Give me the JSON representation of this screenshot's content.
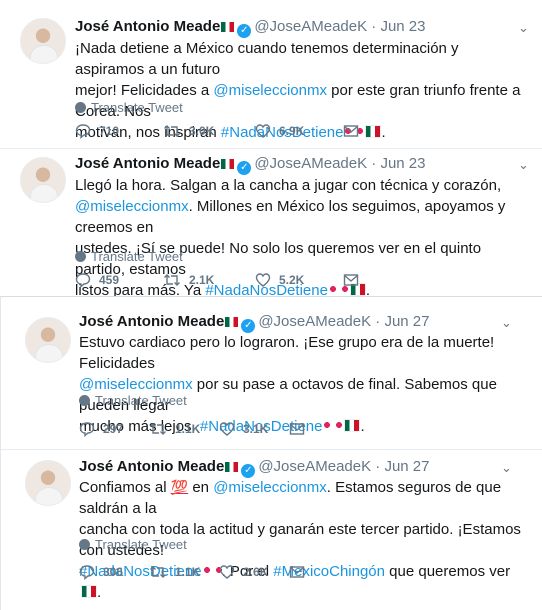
{
  "tweets": [
    {
      "name": "José Antonio Meade",
      "handle": "@JoseAMeadeK",
      "dot": "·",
      "date": "Jun 23",
      "lines": [
        "¡Nada detiene a México cuando tenemos determinación y aspiramos a un futuro",
        [
          "mejor! Felicidades a ",
          "@miseleccionmx",
          " por este gran triunfo frente a Corea. Nos"
        ],
        [
          "motivan, nos inspiran ",
          "#NadaNosDetiene"
        ]
      ],
      "translate": "Translate Tweet",
      "replies": "710",
      "retweets": "3.0K",
      "likes": "6.9K"
    },
    {
      "name": "José Antonio Meade",
      "handle": "@JoseAMeadeK",
      "dot": "·",
      "date": "Jun 23",
      "lines": [
        "Llegó la hora. Salgan a la cancha a jugar con técnica y corazón,",
        [
          "@miseleccionmx",
          ". Millones en México los seguimos, apoyamos y creemos en"
        ],
        "ustedes. ¡Sí se puede! No solo los queremos ver en el quinto partido, estamos",
        [
          "listos para más. Ya ",
          "#NadaNosDetiene"
        ]
      ],
      "translate": "Translate Tweet",
      "replies": "459",
      "retweets": "2.1K",
      "likes": "5.2K"
    },
    {
      "name": "José Antonio Meade",
      "handle": "@JoseAMeadeK",
      "dot": "·",
      "date": "Jun 27",
      "lines": [
        "Estuvo cardiaco pero lo lograron. ¡Ese grupo era de la muerte! Felicidades",
        [
          "@miseleccionmx",
          " por su pase a octavos de final. Sabemos que pueden llegar"
        ],
        [
          "mucho más lejos. ",
          "#NadaNosDetiene"
        ]
      ],
      "translate": "Translate Tweet",
      "replies": "297",
      "retweets": "1.1K",
      "likes": "3.1K"
    },
    {
      "name": "José Antonio Meade",
      "handle": "@JoseAMeadeK",
      "dot": "·",
      "date": "Jun 27",
      "lines": [
        [
          "Confiamos al ",
          "💯",
          " en ",
          "@miseleccionmx",
          ". Estamos seguros de que saldrán a la"
        ],
        "cancha con toda la actitud y ganarán este tercer partido. ¡Estamos con ustedes!",
        [
          "#NadaNosDetiene",
          ". Por el ",
          "#MexicoChingón",
          " que queremos ver"
        ]
      ],
      "translate": "Translate Tweet",
      "replies": "306",
      "retweets": "1.1K",
      "likes": "2.6K"
    }
  ],
  "icons": {
    "reply": "reply-icon",
    "retweet": "retweet-icon",
    "like": "heart-icon",
    "dm": "mail-icon",
    "caret": "chevron-down-icon",
    "verified": "verified-badge-icon"
  },
  "colors": {
    "link": "#1b95e0",
    "hashtag": "#e0245e",
    "muted": "#657786",
    "verified": "#1da1f2"
  }
}
